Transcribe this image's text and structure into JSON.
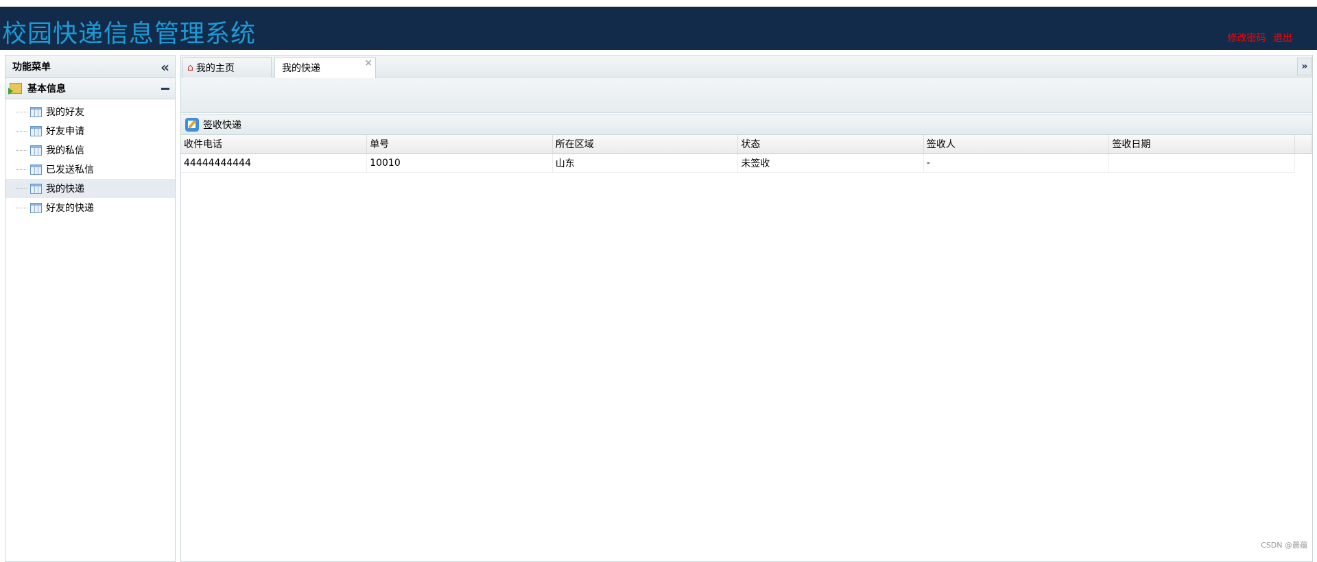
{
  "app": {
    "title": "校园快递信息管理系统",
    "links": [
      "修改密码",
      "退出"
    ]
  },
  "sidebar": {
    "title": "功能菜单",
    "group": "基本信息",
    "items": [
      {
        "label": "我的好友"
      },
      {
        "label": "好友申请"
      },
      {
        "label": "我的私信"
      },
      {
        "label": "已发送私信"
      },
      {
        "label": "我的快递",
        "selected": true
      },
      {
        "label": "好友的快递"
      }
    ]
  },
  "tabs": [
    {
      "label": "我的主页"
    },
    {
      "label": "我的快递",
      "active": true
    }
  ],
  "grid": {
    "title": "签收快递",
    "columns": [
      "收件电话",
      "单号",
      "所在区域",
      "状态",
      "签收人",
      "签收日期"
    ],
    "rows": [
      [
        "44444444444",
        "10010",
        "山东",
        "未签收",
        "-",
        ""
      ]
    ]
  },
  "watermark": "CSDN @晨蕴"
}
